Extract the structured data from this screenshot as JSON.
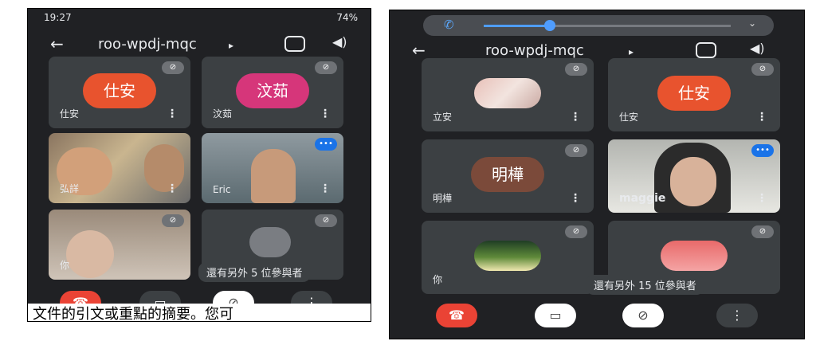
{
  "left": {
    "status_time": "19:27",
    "status_right": "74%",
    "meeting_code": "roo-wpdj-mqc",
    "tiles": [
      {
        "name": "仕安",
        "avatar_text": "仕安",
        "avatar_color": "#e8532e",
        "muted": true
      },
      {
        "name": "汶茹",
        "avatar_text": "汶茹",
        "avatar_color": "#d6367a",
        "muted": true
      },
      {
        "name": "弘詳",
        "video": true
      },
      {
        "name": "Eric",
        "video": true,
        "speaking": true
      },
      {
        "name": "你",
        "video": true,
        "muted": true
      }
    ],
    "others_label": "還有另外 5 位參與者",
    "caption": "文件的引文或重點的摘要。您可"
  },
  "right": {
    "meeting_code": "roo-wpdj-mqc",
    "tiles": [
      {
        "name": "立安",
        "muted": true
      },
      {
        "name": "仕安",
        "avatar_text": "仕安",
        "avatar_color": "#e8532e",
        "muted": true
      },
      {
        "name": "明樺",
        "avatar_text": "明樺",
        "avatar_color": "#7b4a3a",
        "muted": true
      },
      {
        "name": "maggie",
        "video": true,
        "speaking": true
      },
      {
        "name": "你",
        "muted": true
      }
    ],
    "others_label": "還有另外 15 位參與者"
  },
  "colors": {
    "end_call": "#ea4335",
    "speaking": "#1a73e8",
    "background": "#202124"
  }
}
